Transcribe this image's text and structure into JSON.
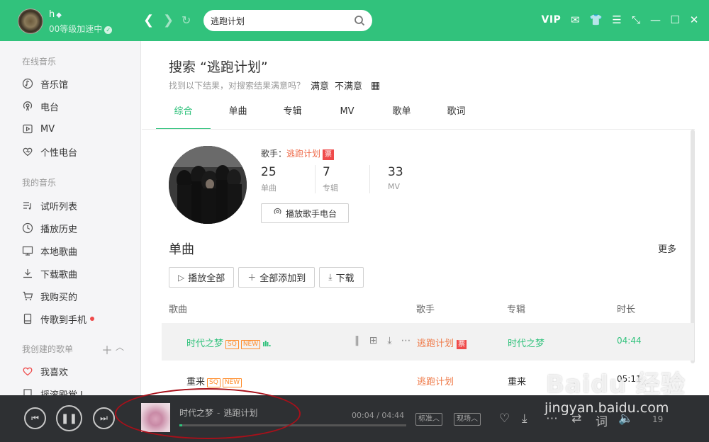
{
  "user": {
    "name": "h",
    "level": "00等级加速中"
  },
  "search": {
    "value": "逃跑计划"
  },
  "topbar": {
    "vip": "VIP"
  },
  "sidebar": {
    "online_head": "在线音乐",
    "online_items": [
      {
        "label": "音乐馆",
        "icon": "music-hall-icon"
      },
      {
        "label": "电台",
        "icon": "radio-icon"
      },
      {
        "label": "MV",
        "icon": "mv-icon"
      },
      {
        "label": "个性电台",
        "icon": "heart-radio-icon"
      }
    ],
    "my_head": "我的音乐",
    "my_items": [
      {
        "label": "试听列表",
        "icon": "playlist-icon"
      },
      {
        "label": "播放历史",
        "icon": "clock-icon"
      },
      {
        "label": "本地歌曲",
        "icon": "monitor-icon"
      },
      {
        "label": "下载歌曲",
        "icon": "download-icon"
      },
      {
        "label": "我购买的",
        "icon": "cart-icon"
      },
      {
        "label": "传歌到手机",
        "icon": "phone-icon"
      }
    ],
    "created_head": "我创建的歌单",
    "created_items": [
      {
        "label": "我喜欢",
        "icon": "heart-icon"
      },
      {
        "label": "摇滚殿堂 I",
        "icon": "playlist-icon"
      }
    ]
  },
  "main": {
    "title": "搜索 “逃跑计划”",
    "feedback_text": "找到以下结果，对搜索结果满意吗？",
    "satisfied": "满意",
    "unsatisfied": "不满意",
    "tabs": [
      "综合",
      "单曲",
      "专辑",
      "MV",
      "歌单",
      "歌词"
    ],
    "artist": {
      "label_prefix": "歌手：",
      "name": "逃跑计划",
      "ticket": "票",
      "stats": [
        {
          "num": "25",
          "label": "单曲"
        },
        {
          "num": "7",
          "label": "专辑"
        },
        {
          "num": "33",
          "label": "MV"
        }
      ],
      "radio_button": "播放歌手电台"
    },
    "section_title": "单曲",
    "more": "更多",
    "actions": {
      "play_all": "播放全部",
      "add_all": "全部添加到",
      "download": "下载"
    },
    "columns": {
      "song": "歌曲",
      "singer": "歌手",
      "album": "专辑",
      "duration": "时长"
    },
    "songs": [
      {
        "title": "时代之梦",
        "sq": "SQ",
        "new": "NEW",
        "singer": "逃跑计划",
        "ticket": "票",
        "album": "时代之梦",
        "duration": "04:44"
      },
      {
        "title": "重来",
        "sq": "SQ",
        "new": "NEW",
        "singer": "逃跑计划",
        "album": "重来",
        "duration": "05:11"
      }
    ]
  },
  "player": {
    "song": "时代之梦",
    "artist": "逃跑计划",
    "current_time": "00:04",
    "total_time": "04:44",
    "progress": 0.014,
    "quality": "标准",
    "mode": "现场",
    "volume": "19"
  },
  "watermark": {
    "logo": "Baidu 经验",
    "url": "jingyan.baidu.com"
  },
  "colors": {
    "brand": "#31c27c",
    "player_bg": "#2e3033",
    "accent_orange": "#ef7b4a",
    "annotation": "#a8101a"
  }
}
